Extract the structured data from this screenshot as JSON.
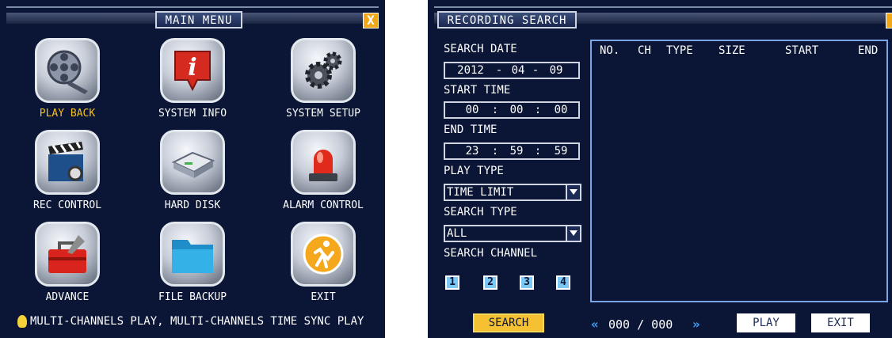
{
  "main_menu": {
    "title": "MAIN MENU",
    "close_label": "X",
    "items": [
      {
        "label": "PLAY BACK",
        "icon": "film-reel-icon",
        "active": true
      },
      {
        "label": "SYSTEM INFO",
        "icon": "info-icon"
      },
      {
        "label": "SYSTEM SETUP",
        "icon": "gear-icon"
      },
      {
        "label": "REC CONTROL",
        "icon": "clapperboard-icon"
      },
      {
        "label": "HARD DISK",
        "icon": "hard-disk-icon"
      },
      {
        "label": "ALARM CONTROL",
        "icon": "alarm-siren-icon"
      },
      {
        "label": "ADVANCE",
        "icon": "toolbox-icon"
      },
      {
        "label": "FILE BACKUP",
        "icon": "folder-icon"
      },
      {
        "label": "EXIT",
        "icon": "exit-icon"
      }
    ],
    "info_text": "MULTI-CHANNELS PLAY, MULTI-CHANNELS TIME SYNC PLAY"
  },
  "recording_search": {
    "title": "RECORDING SEARCH",
    "search_date_label": "SEARCH DATE",
    "search_date": {
      "year": "2012",
      "sep": "-",
      "month": "04",
      "day": "09"
    },
    "start_time_label": "START TIME",
    "start_time": {
      "h": "00",
      "m": "00",
      "s": "00",
      "sep": ":"
    },
    "end_time_label": "END TIME",
    "end_time": {
      "h": "23",
      "m": "59",
      "s": "59",
      "sep": ":"
    },
    "play_type_label": "PLAY TYPE",
    "play_type_value": "TIME LIMIT",
    "search_type_label": "SEARCH TYPE",
    "search_type_value": "ALL",
    "search_channel_label": "SEARCH CHANNEL",
    "channels": [
      "1",
      "2",
      "3",
      "4"
    ],
    "columns": [
      "NO.",
      "CH",
      "TYPE",
      "SIZE",
      "START",
      "END"
    ],
    "search_button": "SEARCH",
    "page_count": "000 / 000",
    "prev_arrow": "«",
    "next_arrow": "»",
    "play_button": "PLAY",
    "exit_button": "EXIT"
  }
}
